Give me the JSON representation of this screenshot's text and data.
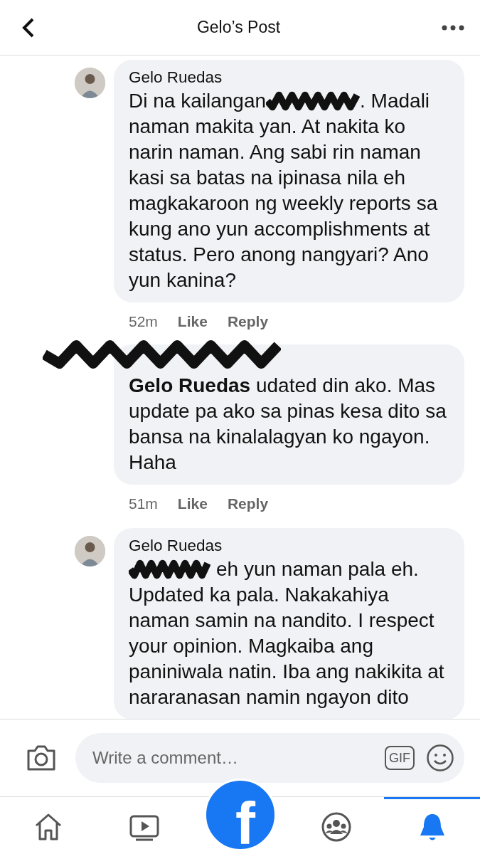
{
  "header": {
    "title": "Gelo’s Post"
  },
  "comments": [
    {
      "author": "Gelo Ruedas",
      "author_redacted": false,
      "first_line": [
        {
          "kind": "text",
          "text": "Di na kailangan"
        },
        {
          "kind": "redacted"
        },
        {
          "kind": "text",
          "text": ". Madali"
        }
      ],
      "text": "naman makita yan. At nakita ko narin naman. Ang sabi rin naman kasi sa batas na ipinasa nila eh magkakaroon ng weekly reports sa kung ano yun accomplishments at status. Pero anong nangyari? Ano yun kanina?",
      "time": "52m",
      "actions": [
        "Like",
        "Reply"
      ]
    },
    {
      "author_redacted": true,
      "text": "**Gelo Ruedas** udated din ako. Mas update pa ako sa pinas kesa dito sa bansa na kinalalagyan ko ngayon. Haha",
      "time": "51m",
      "actions": [
        "Like",
        "Reply"
      ]
    },
    {
      "author": "Gelo Ruedas",
      "author_redacted": false,
      "first_line": [
        {
          "kind": "redacted"
        },
        {
          "kind": "text",
          "text": "eh yun naman pala eh."
        }
      ],
      "text": "Updated ka pala. Nakakahiya naman samin na nandito. I respect your opinion. Magkaiba ang paniniwala natin. Iba ang nakikita at nararanasan namin ngayon dito"
    }
  ],
  "composer": {
    "placeholder": "Write a comment…",
    "gif": "GIF"
  },
  "tabs": [
    {
      "kind": "home",
      "selected": false
    },
    {
      "kind": "video",
      "selected": false
    },
    {
      "kind": "logo",
      "label": "f"
    },
    {
      "kind": "groups",
      "selected": false
    },
    {
      "kind": "bell",
      "selected": true
    }
  ]
}
